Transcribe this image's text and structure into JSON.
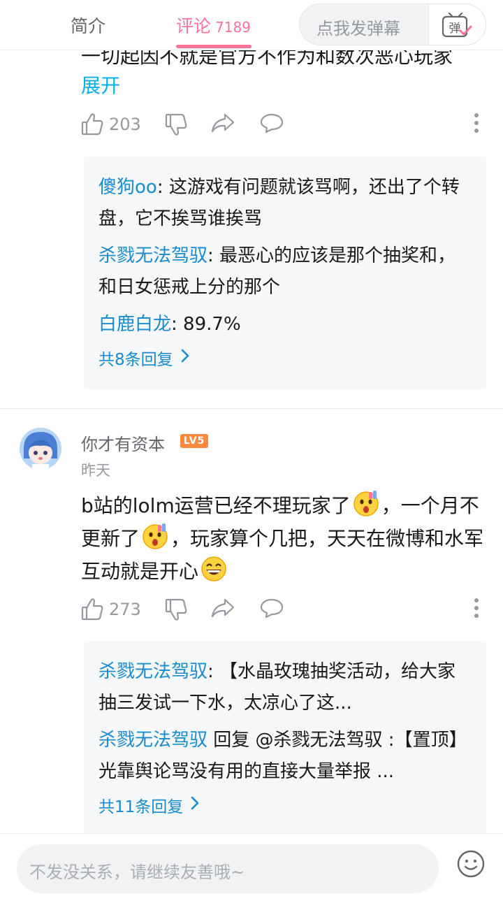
{
  "tabs": {
    "intro": "简介",
    "comments": "评论",
    "comments_count": "7189"
  },
  "danmaku": {
    "placeholder": "点我发弹幕",
    "toggle_glyph": "弹"
  },
  "comment1": {
    "cut_text": "一切起因不就是官方不作为和数次恶心玩家",
    "expand": "展开",
    "likes": "203",
    "replies": [
      {
        "user": "傻狗oo",
        "text": "这游戏有问题就该骂啊，还出了个转盘，它不挨骂谁挨骂"
      },
      {
        "user": "杀戮无法驾驭",
        "text": "最恶心的应该是那个抽奖和，和日女惩戒上分的那个"
      },
      {
        "user": "白鹿白龙",
        "text": "89.7%"
      }
    ],
    "more_replies": "共8条回复"
  },
  "comment2": {
    "user": "你才有资本",
    "level": "LV5",
    "time": "昨天",
    "text_part1": "b站的lolm运营已经不理玩家了",
    "text_part2": "，一个月不更新了",
    "text_part3": "，玩家算个几把，天天在微博和水军互动就是开心",
    "likes": "273",
    "replies": [
      {
        "user": "杀戮无法驾驭",
        "sep": ": ",
        "text": "【水晶玫瑰抽奖活动，给大家抽三发试一下水，太凉心了这..."
      },
      {
        "user": "杀戮无法驾驭",
        "sep": " ",
        "text": "回复 @杀戮无法驾驭 :【置顶】光靠舆论骂没有用的直接大量举报 ..."
      }
    ],
    "more_replies": "共11条回复"
  },
  "bottom": {
    "placeholder": "不发没关系，请继续友善哦~"
  },
  "colors": {
    "accent_pink": "#fb7299",
    "link_blue": "#178bcf",
    "expand_blue": "#00aeec",
    "level_orange": "#ff8a3d"
  }
}
